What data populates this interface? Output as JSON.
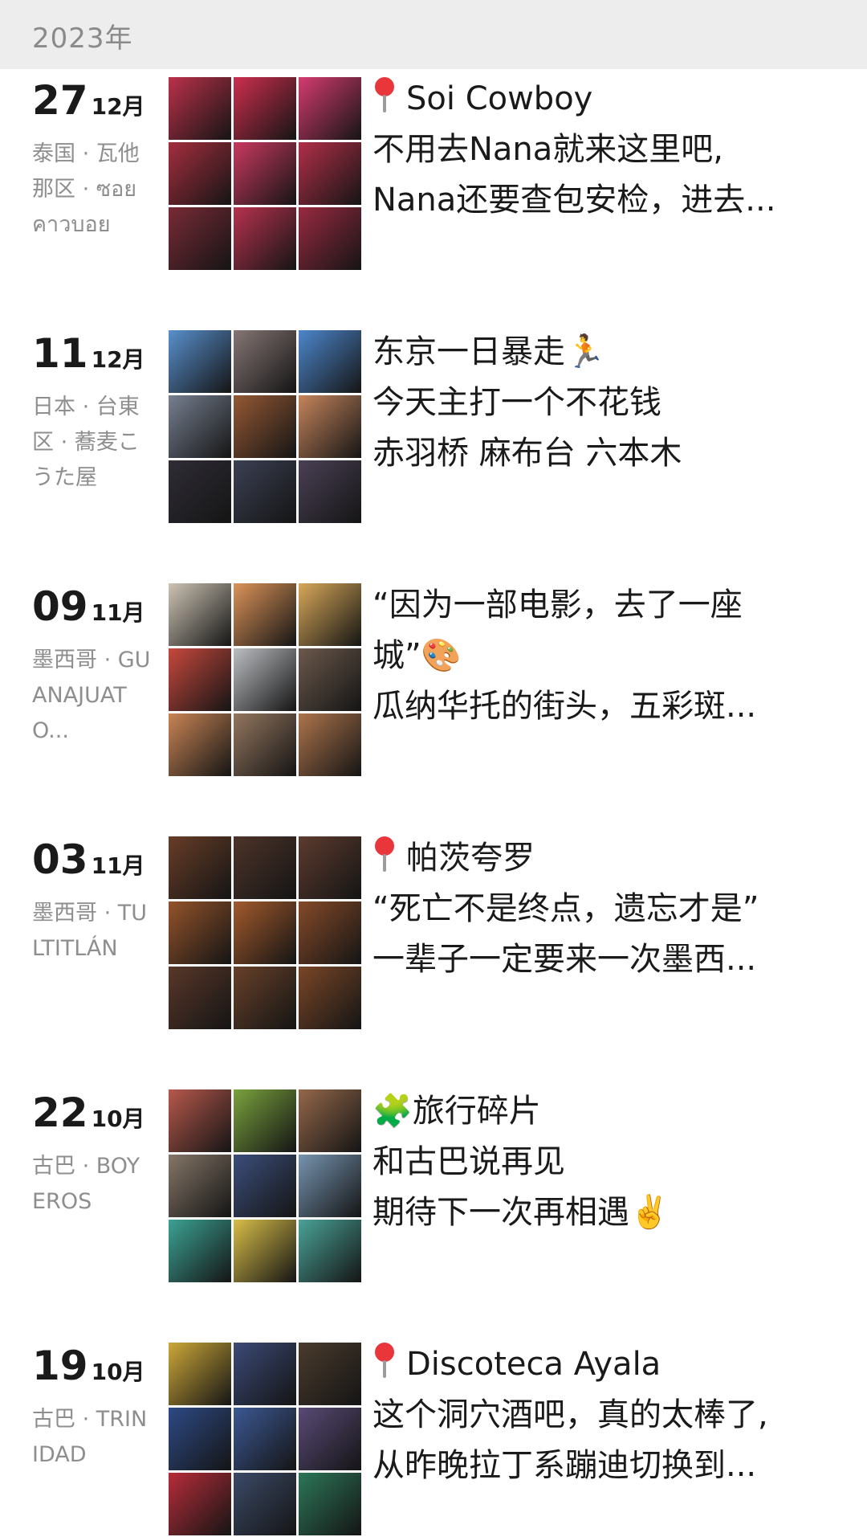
{
  "year_label": "2023年",
  "entries": [
    {
      "day": "27",
      "month": "12月",
      "location": "泰国 · 瓦他那区 · ซอย คาวบอย",
      "lines": [
        {
          "icon": "pin",
          "text": "Soi Cowboy"
        },
        {
          "text": "不用去Nana就来这里吧,"
        },
        {
          "text": "Nana还要查包安检，进去..."
        }
      ],
      "photo_colors": [
        "#b51f3a",
        "#c81c3e",
        "#d02a63",
        "#9c1c2d",
        "#c42852",
        "#aa1d38",
        "#6d1825",
        "#b0203f",
        "#8f1730"
      ]
    },
    {
      "day": "11",
      "month": "12月",
      "location": "日本 · 台東区 · 蕎麦こうた屋",
      "lines": [
        {
          "text": "东京一日暴走",
          "emoji": "🏃"
        },
        {
          "text": "今天主打一个不花钱"
        },
        {
          "text": "赤羽桥 麻布台 六本木"
        }
      ],
      "photo_colors": [
        "#4a86c8",
        "#7a6a68",
        "#3d7cc7",
        "#6a7486",
        "#8b4a22",
        "#c07a4e",
        "#1d1a24",
        "#2a2f44",
        "#3a3046"
      ]
    },
    {
      "day": "09",
      "month": "11月",
      "location": "墨西哥 · GUANAJUATO...",
      "lines": [
        {
          "text": "“因为一部电影，去了一座"
        },
        {
          "text": "城”",
          "emoji": "🎨"
        },
        {
          "text": "瓜纳华托的街头，五彩斑..."
        }
      ],
      "photo_colors": [
        "#c9bfae",
        "#d98a4a",
        "#d4a04a",
        "#c2382c",
        "#b6b8bc",
        "#5e4a3c",
        "#c47a46",
        "#8a6a50",
        "#a6683c"
      ]
    },
    {
      "day": "03",
      "month": "11月",
      "location": "墨西哥 · TULTITLÁN",
      "lines": [
        {
          "icon": "pin",
          "text": "帕茨夸罗"
        },
        {
          "text": "“死亡不是终点，遗忘才是”"
        },
        {
          "text": "一辈子一定要来一次墨西..."
        }
      ],
      "photo_colors": [
        "#5a2c14",
        "#3d2216",
        "#4e2a1c",
        "#8a4418",
        "#9a4c1a",
        "#7a3a16",
        "#4a2616",
        "#5a3016",
        "#6e3614"
      ]
    },
    {
      "day": "22",
      "month": "10月",
      "location": "古巴 · BOYEROS",
      "lines": [
        {
          "text": "旅行碎片",
          "emoji_before": "🧩"
        },
        {
          "text": "和古巴说再见"
        },
        {
          "text": "期待下一次再相遇",
          "emoji": "✌️"
        }
      ],
      "photo_colors": [
        "#b04a3c",
        "#6e9a2c",
        "#8a5a3a",
        "#7a6a5a",
        "#2a3e6e",
        "#6a8aa8",
        "#2a9a8a",
        "#d4b838",
        "#3a9a8e"
      ]
    },
    {
      "day": "19",
      "month": "10月",
      "location": "古巴 · TRINIDAD",
      "lines": [
        {
          "icon": "pin",
          "text": "Discoteca Ayala"
        },
        {
          "text": "这个洞穴酒吧，真的太棒了,"
        },
        {
          "text": "从昨晚拉丁系蹦迪切换到..."
        }
      ],
      "photo_colors": [
        "#c8a028",
        "#2a3a6a",
        "#3a2a1a",
        "#1a3a7a",
        "#2a4a8a",
        "#4a3a6a",
        "#b01a28",
        "#2a3a5a",
        "#1a6a4a"
      ]
    }
  ]
}
